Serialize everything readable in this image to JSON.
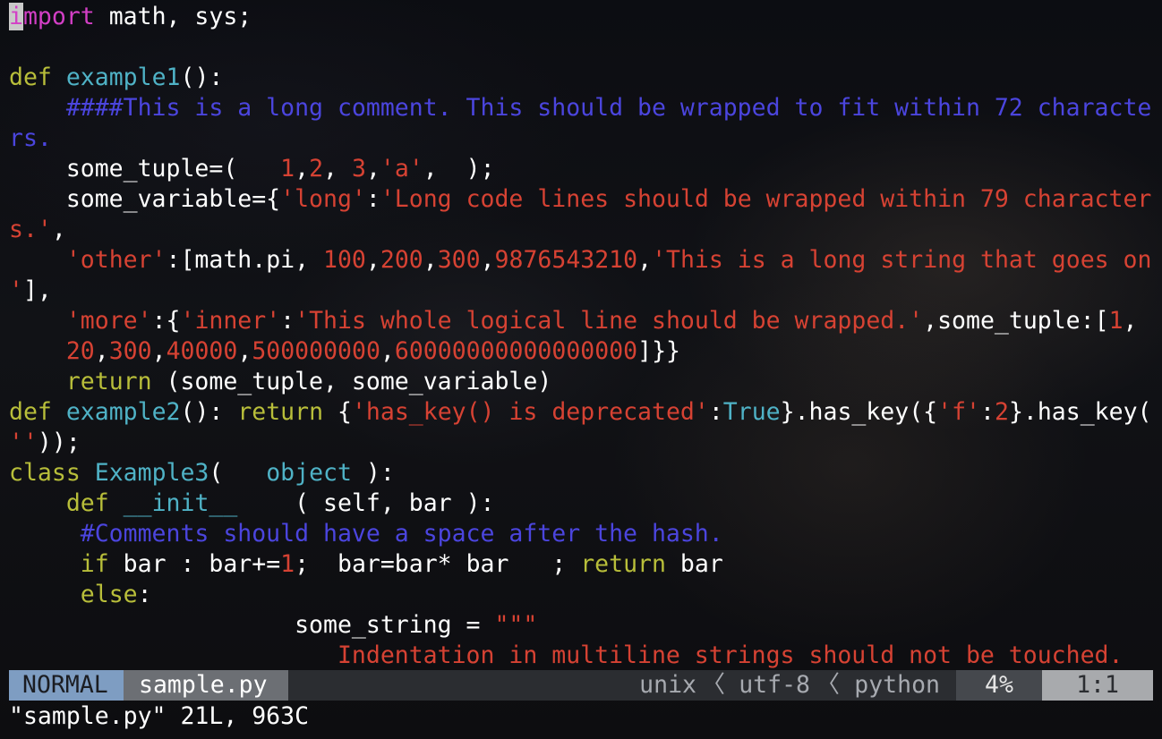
{
  "editor": {
    "lines": [
      [
        {
          "t": "i",
          "c": "cursor"
        },
        {
          "t": "mport",
          "c": "imp"
        },
        {
          "t": " math, sys;",
          "c": ""
        }
      ],
      [],
      [
        {
          "t": "def",
          "c": "kw"
        },
        {
          "t": " ",
          "c": ""
        },
        {
          "t": "example1",
          "c": "fn"
        },
        {
          "t": "():",
          "c": ""
        }
      ],
      [
        {
          "t": "    ####This is a long comment. This should be wrapped to fit within 72 characte",
          "c": "cm"
        }
      ],
      [
        {
          "t": "rs.",
          "c": "cm"
        }
      ],
      [
        {
          "t": "    some_tuple=(   ",
          "c": ""
        },
        {
          "t": "1",
          "c": "num"
        },
        {
          "t": ",",
          "c": ""
        },
        {
          "t": "2",
          "c": "num"
        },
        {
          "t": ", ",
          "c": ""
        },
        {
          "t": "3",
          "c": "num"
        },
        {
          "t": ",",
          "c": ""
        },
        {
          "t": "'a'",
          "c": "str"
        },
        {
          "t": ",  );",
          "c": ""
        }
      ],
      [
        {
          "t": "    some_variable={",
          "c": ""
        },
        {
          "t": "'long'",
          "c": "str"
        },
        {
          "t": ":",
          "c": ""
        },
        {
          "t": "'Long code lines should be wrapped within 79 character",
          "c": "str"
        }
      ],
      [
        {
          "t": "s.'",
          "c": "str"
        },
        {
          "t": ",",
          "c": ""
        }
      ],
      [
        {
          "t": "    ",
          "c": ""
        },
        {
          "t": "'other'",
          "c": "str"
        },
        {
          "t": ":[math.pi, ",
          "c": ""
        },
        {
          "t": "100",
          "c": "num"
        },
        {
          "t": ",",
          "c": ""
        },
        {
          "t": "200",
          "c": "num"
        },
        {
          "t": ",",
          "c": ""
        },
        {
          "t": "300",
          "c": "num"
        },
        {
          "t": ",",
          "c": ""
        },
        {
          "t": "9876543210",
          "c": "num"
        },
        {
          "t": ",",
          "c": ""
        },
        {
          "t": "'This is a long string that goes on",
          "c": "str"
        }
      ],
      [
        {
          "t": "'",
          "c": "str"
        },
        {
          "t": "],",
          "c": ""
        }
      ],
      [
        {
          "t": "    ",
          "c": ""
        },
        {
          "t": "'more'",
          "c": "str"
        },
        {
          "t": ":{",
          "c": ""
        },
        {
          "t": "'inner'",
          "c": "str"
        },
        {
          "t": ":",
          "c": ""
        },
        {
          "t": "'This whole logical line should be wrapped.'",
          "c": "str"
        },
        {
          "t": ",some_tuple:[",
          "c": ""
        },
        {
          "t": "1",
          "c": "num"
        },
        {
          "t": ",",
          "c": ""
        }
      ],
      [
        {
          "t": "    ",
          "c": ""
        },
        {
          "t": "20",
          "c": "num"
        },
        {
          "t": ",",
          "c": ""
        },
        {
          "t": "300",
          "c": "num"
        },
        {
          "t": ",",
          "c": ""
        },
        {
          "t": "40000",
          "c": "num"
        },
        {
          "t": ",",
          "c": ""
        },
        {
          "t": "500000000",
          "c": "num"
        },
        {
          "t": ",",
          "c": ""
        },
        {
          "t": "60000000000000000",
          "c": "num"
        },
        {
          "t": "]}}",
          "c": ""
        }
      ],
      [
        {
          "t": "    ",
          "c": ""
        },
        {
          "t": "return",
          "c": "kw"
        },
        {
          "t": " (some_tuple, some_variable)",
          "c": ""
        }
      ],
      [
        {
          "t": "def",
          "c": "kw"
        },
        {
          "t": " ",
          "c": ""
        },
        {
          "t": "example2",
          "c": "fn"
        },
        {
          "t": "(): ",
          "c": ""
        },
        {
          "t": "return",
          "c": "kw"
        },
        {
          "t": " {",
          "c": ""
        },
        {
          "t": "'has_key() is deprecated'",
          "c": "str"
        },
        {
          "t": ":",
          "c": ""
        },
        {
          "t": "True",
          "c": "bi"
        },
        {
          "t": "}.has_key({",
          "c": ""
        },
        {
          "t": "'f'",
          "c": "str"
        },
        {
          "t": ":",
          "c": ""
        },
        {
          "t": "2",
          "c": "num"
        },
        {
          "t": "}.has_key(",
          "c": ""
        }
      ],
      [
        {
          "t": "''",
          "c": "str"
        },
        {
          "t": "));",
          "c": ""
        }
      ],
      [
        {
          "t": "class",
          "c": "kw"
        },
        {
          "t": " ",
          "c": ""
        },
        {
          "t": "Example3",
          "c": "fn"
        },
        {
          "t": "(   ",
          "c": ""
        },
        {
          "t": "object",
          "c": "bi"
        },
        {
          "t": " ):",
          "c": ""
        }
      ],
      [
        {
          "t": "    ",
          "c": ""
        },
        {
          "t": "def",
          "c": "kw"
        },
        {
          "t": " ",
          "c": ""
        },
        {
          "t": "__init__",
          "c": "fn"
        },
        {
          "t": "    ( self, bar ):",
          "c": ""
        }
      ],
      [
        {
          "t": "     #Comments should have a space after the hash.",
          "c": "cm"
        }
      ],
      [
        {
          "t": "     ",
          "c": ""
        },
        {
          "t": "if",
          "c": "kw"
        },
        {
          "t": " bar : bar+=",
          "c": ""
        },
        {
          "t": "1",
          "c": "num"
        },
        {
          "t": ";  bar=bar* bar   ; ",
          "c": ""
        },
        {
          "t": "return",
          "c": "kw"
        },
        {
          "t": " bar",
          "c": ""
        }
      ],
      [
        {
          "t": "     ",
          "c": ""
        },
        {
          "t": "else",
          "c": "kw"
        },
        {
          "t": ":",
          "c": ""
        }
      ],
      [
        {
          "t": "                    some_string = ",
          "c": ""
        },
        {
          "t": "\"\"\"",
          "c": "str"
        }
      ],
      [
        {
          "t": "                       Indentation in multiline strings should not be touched.",
          "c": "str"
        }
      ]
    ]
  },
  "statusline": {
    "mode": "NORMAL",
    "filename": "sample.py",
    "fileformat": "unix",
    "separator": "〈",
    "encoding": "utf-8",
    "filetype": "python",
    "percent": "4%",
    "position": "1:1"
  },
  "cmdline": {
    "message": "\"sample.py\" 21L, 963C"
  },
  "colors": {
    "keyword": "#b8be3a",
    "function": "#4fb2c6",
    "string": "#d64233",
    "comment": "#4b45de",
    "import": "#d33fc6",
    "mode_bg": "#7e9dc2"
  }
}
